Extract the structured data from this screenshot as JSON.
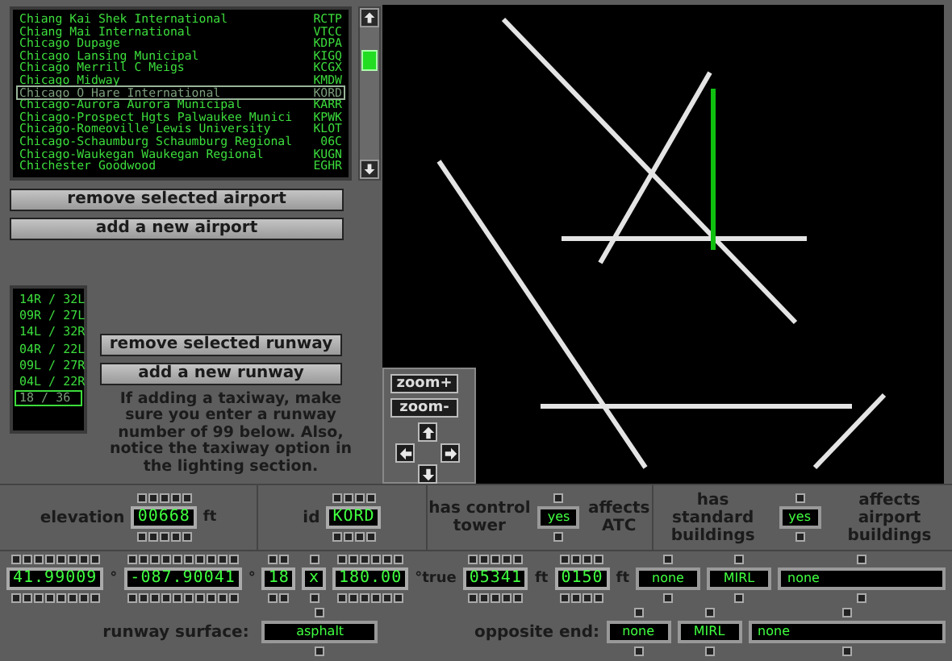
{
  "airport_list": {
    "items": [
      {
        "name": "Chiang Kai Shek International",
        "code": "RCTP",
        "selected": false
      },
      {
        "name": "Chiang Mai International",
        "code": "VTCC",
        "selected": false
      },
      {
        "name": "Chicago Dupage",
        "code": "KDPA",
        "selected": false
      },
      {
        "name": "Chicago Lansing Municipal",
        "code": "KIGQ",
        "selected": false
      },
      {
        "name": "Chicago Merrill C Meigs",
        "code": "KCGX",
        "selected": false
      },
      {
        "name": "Chicago Midway",
        "code": "KMDW",
        "selected": false
      },
      {
        "name": "Chicago O Hare International",
        "code": "KORD",
        "selected": true
      },
      {
        "name": "Chicago-Aurora Aurora Municipal",
        "code": "KARR",
        "selected": false
      },
      {
        "name": "Chicago-Prospect Hgts Palwaukee Munici",
        "code": "KPWK",
        "selected": false
      },
      {
        "name": "Chicago-Romeoville Lewis University",
        "code": "KLOT",
        "selected": false
      },
      {
        "name": "Chicago-Schaumburg Schaumburg Regional",
        "code": "06C",
        "selected": false
      },
      {
        "name": "Chicago-Waukegan Waukegan Regional",
        "code": "KUGN",
        "selected": false
      },
      {
        "name": "Chichester Goodwood",
        "code": "EGHR",
        "selected": false
      }
    ]
  },
  "airport_buttons": [
    "remove selected airport",
    "add a new airport"
  ],
  "runway_list": {
    "items": [
      {
        "label": "14R / 32L",
        "selected": false
      },
      {
        "label": "09R / 27L",
        "selected": false
      },
      {
        "label": "14L / 32R",
        "selected": false
      },
      {
        "label": "04R / 22L",
        "selected": false
      },
      {
        "label": "09L / 27R",
        "selected": false
      },
      {
        "label": "04L / 22R",
        "selected": false
      },
      {
        "label": "18 / 36",
        "selected": true
      }
    ]
  },
  "runway_buttons": [
    "remove selected runway",
    "add a new runway"
  ],
  "help_text": "If adding a taxiway, make sure you enter a runway number of 99 below. Also, notice the taxiway option in the lighting section.",
  "map": {
    "zoom_buttons": [
      "zoom+",
      "zoom-"
    ]
  },
  "airport_fields": [
    {
      "kind": "spinner",
      "label": "elevation",
      "value": "00668",
      "unit": "ft"
    },
    {
      "kind": "spinner",
      "label": "id",
      "value": "KORD"
    },
    {
      "kind": "toggle",
      "label": "has control tower",
      "value": "yes",
      "note": "affects ATC"
    },
    {
      "kind": "toggle",
      "label": "has standard buildings",
      "value": "yes",
      "note": "affects airport buildings"
    }
  ],
  "runway_fields": [
    {
      "kind": "spinner",
      "value": "41.99009",
      "unit": "°"
    },
    {
      "kind": "spinner",
      "value": "-087.90041",
      "unit": "°"
    },
    {
      "kind": "spinner",
      "value": "18"
    },
    {
      "kind": "spinner",
      "value": "x"
    },
    {
      "kind": "spinner",
      "value": "180.00",
      "unit": "°true"
    },
    {
      "kind": "spinner",
      "value": "05341",
      "unit": "ft"
    },
    {
      "kind": "spinner",
      "value": "0150",
      "unit": "ft"
    },
    {
      "kind": "select",
      "value": "none"
    },
    {
      "kind": "select",
      "value": "MIRL"
    },
    {
      "kind": "select",
      "value": "none"
    }
  ],
  "surface": {
    "label": "runway surface:",
    "value": "asphalt"
  },
  "opposite_end": {
    "label": "opposite end:",
    "selects": [
      "none",
      "MIRL",
      "none"
    ]
  }
}
